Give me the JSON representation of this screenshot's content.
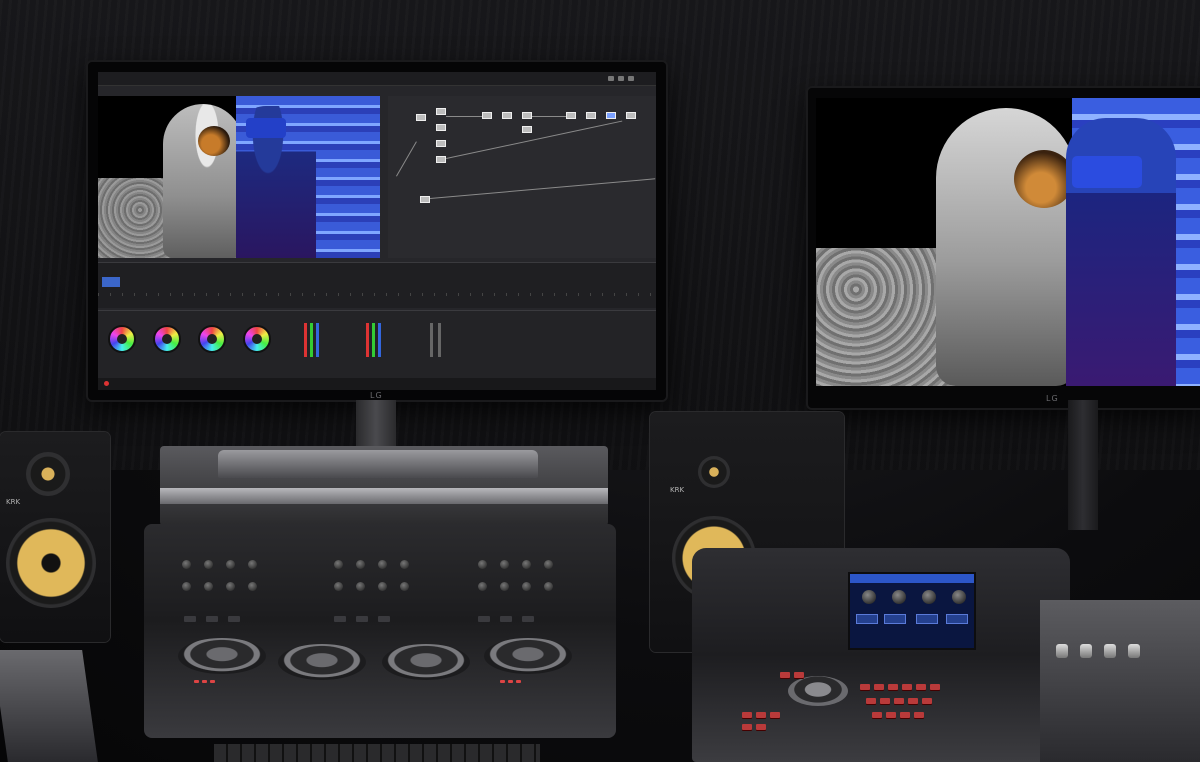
{
  "scene": {
    "description_tags": [
      "color-grading-suite",
      "two-monitors",
      "control-surfaces",
      "studio-speakers"
    ]
  },
  "left_monitor": {
    "brand": "LG"
  },
  "right_monitor": {
    "brand": "LG"
  },
  "speakers": {
    "left_label": "KRK",
    "right_label": "KRK"
  },
  "colors": {
    "blue_stripe": "#3a5bd8",
    "speaker_cone": "#e0b85a",
    "panel_red_keys": "#b93a3a"
  }
}
